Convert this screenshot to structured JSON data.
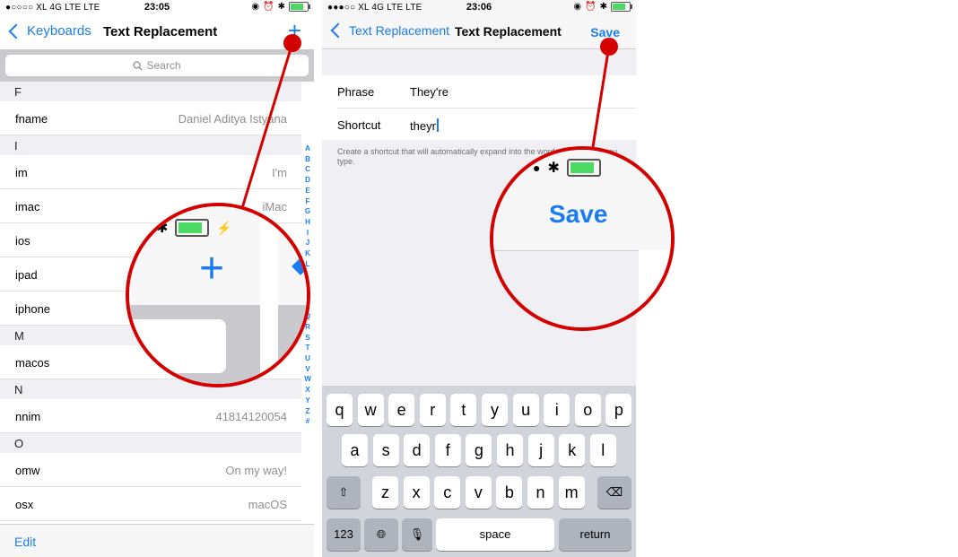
{
  "left_screen": {
    "status": {
      "carrier": "●○○○○ XL 4G LTE  LTE",
      "time": "23:05"
    },
    "nav": {
      "back_label": "Keyboards",
      "title": "Text Replacement",
      "add_symbol": "+"
    },
    "search": {
      "placeholder": "Search"
    },
    "sections": [
      {
        "letter": "F",
        "rows": [
          {
            "phrase": "fname",
            "replacement": "Daniel Aditya Istyana"
          }
        ]
      },
      {
        "letter": "I",
        "rows": [
          {
            "phrase": "im",
            "replacement": "I'm"
          },
          {
            "phrase": "imac",
            "replacement": "iMac"
          },
          {
            "phrase": "ios",
            "replacement": ""
          },
          {
            "phrase": "ipad",
            "replacement": ""
          },
          {
            "phrase": "iphone",
            "replacement": ""
          }
        ]
      },
      {
        "letter": "M",
        "rows": [
          {
            "phrase": "macos",
            "replacement": ""
          }
        ]
      },
      {
        "letter": "N",
        "rows": [
          {
            "phrase": "nnim",
            "replacement": "41814120054"
          }
        ]
      },
      {
        "letter": "O",
        "rows": [
          {
            "phrase": "omw",
            "replacement": "On my way!"
          },
          {
            "phrase": "osx",
            "replacement": "macOS"
          }
        ]
      }
    ],
    "index_letters": [
      "A",
      "B",
      "C",
      "D",
      "E",
      "F",
      "G",
      "H",
      "I",
      "J",
      "K",
      "L",
      "",
      "",
      "",
      "",
      "Q",
      "R",
      "S",
      "T",
      "U",
      "V",
      "W",
      "X",
      "Y",
      "Z",
      "#"
    ],
    "toolbar": {
      "edit_label": "Edit"
    },
    "magnifier": {
      "plus_symbol": "+"
    }
  },
  "right_screen": {
    "status": {
      "carrier": "●●●○○ XL 4G LTE  LTE",
      "time": "23:06"
    },
    "nav": {
      "back_label": "Text Replacement",
      "title": "Text Replacement",
      "save_label": "Save"
    },
    "form": {
      "phrase_label": "Phrase",
      "phrase_value": "They're",
      "shortcut_label": "Shortcut",
      "shortcut_value": "theyr"
    },
    "hint": "Create a shortcut that will automatically expand into the word or phrase as you type.",
    "keyboard": {
      "row1": [
        "q",
        "w",
        "e",
        "r",
        "t",
        "y",
        "u",
        "i",
        "o",
        "p"
      ],
      "row2": [
        "a",
        "s",
        "d",
        "f",
        "g",
        "h",
        "j",
        "k",
        "l"
      ],
      "row3": [
        "z",
        "x",
        "c",
        "v",
        "b",
        "n",
        "m"
      ],
      "numbers_label": "123",
      "space_label": "space",
      "return_label": "return"
    },
    "magnifier": {
      "save_label": "Save"
    }
  },
  "colors": {
    "accent": "#1a7cf0",
    "annotation": "#d40000",
    "battery": "#4cd964"
  }
}
